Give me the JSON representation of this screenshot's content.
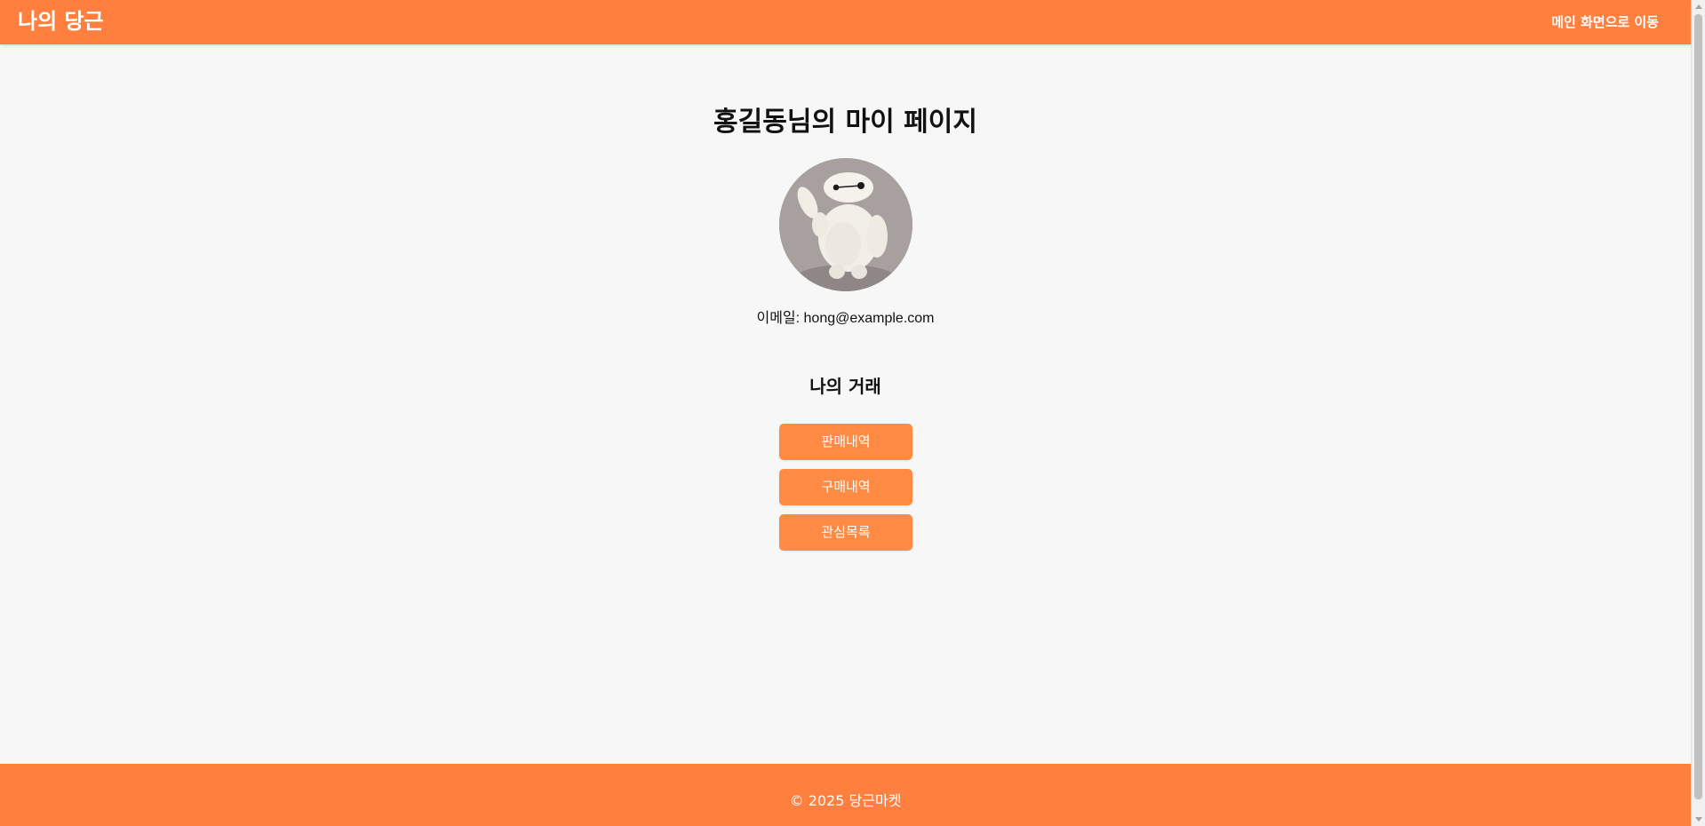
{
  "header": {
    "logo": "나의 당근",
    "nav_link": "메인 화면으로 이동"
  },
  "profile": {
    "title": "홍길동님의 마이 페이지",
    "email_label": "이메일: hong@example.com",
    "avatar_icon": "avatar-image"
  },
  "trades": {
    "section_title": "나의 거래",
    "sales_button": "판매내역",
    "purchase_button": "구매내역",
    "wishlist_button": "관심목록"
  },
  "footer": {
    "copyright": "© 2025 당근마켓"
  },
  "colors": {
    "brand": "#ff7f3f",
    "button": "#ff8a44",
    "background": "#f7f7f7"
  }
}
